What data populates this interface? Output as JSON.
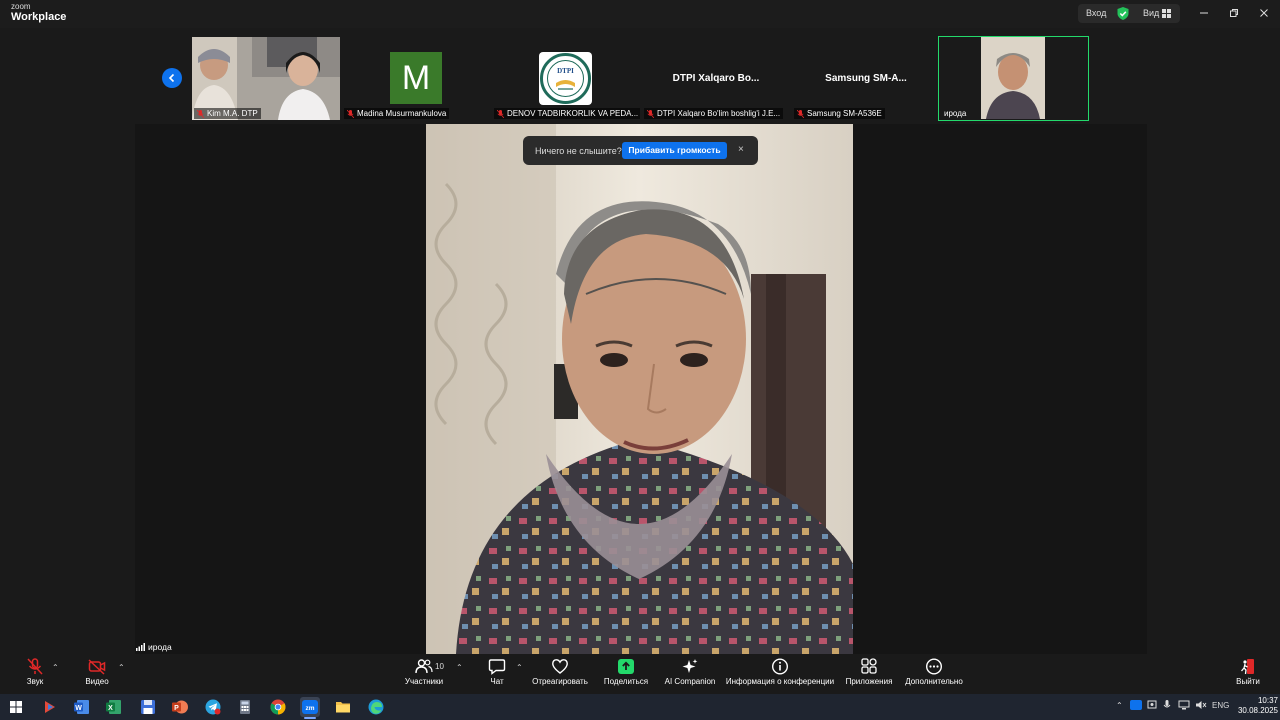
{
  "app": {
    "logo_top": "zoom",
    "logo_bottom": "Workplace"
  },
  "titlebar": {
    "login": "Вход",
    "view": "Вид"
  },
  "participants_strip": [
    {
      "name": "Kim M.A. DTP",
      "type": "video-two-people"
    },
    {
      "name": "Madina Musurmankulova",
      "type": "avatar-letter",
      "letter": "M",
      "color": "#3a7a2a"
    },
    {
      "name": "DENOV TADBIRKORLIK VA PEDA...",
      "type": "avatar-logo",
      "logo_text": "DTPI"
    },
    {
      "name": "DTPI Xalqaro Bo'lim boshlig'i J.E...",
      "type": "name-only",
      "display": "DTPI Xalqaro Bo..."
    },
    {
      "name": "Samsung SM-A536E",
      "type": "name-only",
      "display": "Samsung SM-A..."
    },
    {
      "name": "ирода",
      "type": "video-active"
    }
  ],
  "main_video": {
    "speaker_name": "ирода"
  },
  "toast": {
    "message": "Ничего не слышите?",
    "button": "Прибавить громкость",
    "close": "×"
  },
  "toolbar": {
    "audio": "Звук",
    "video": "Видео",
    "participants": "Участники",
    "participants_count": "10",
    "chat": "Чат",
    "react": "Отреагировать",
    "share": "Поделиться",
    "ai": "AI Companion",
    "info": "Информация о конференции",
    "apps": "Приложения",
    "more": "Дополнительно",
    "leave": "Выйти"
  },
  "taskbar": {
    "language": "ENG",
    "time": "10:37",
    "date": "30.08.2025",
    "apps": [
      "windows-start",
      "media-app",
      "word",
      "excel",
      "save-app",
      "powerpoint",
      "telegram",
      "calculator",
      "chrome",
      "zoom",
      "file-explorer",
      "edge"
    ]
  },
  "colors": {
    "accent": "#0e72ed",
    "active_border": "#23d96b",
    "share_green": "#23d96b",
    "muted_red": "#e02828"
  }
}
